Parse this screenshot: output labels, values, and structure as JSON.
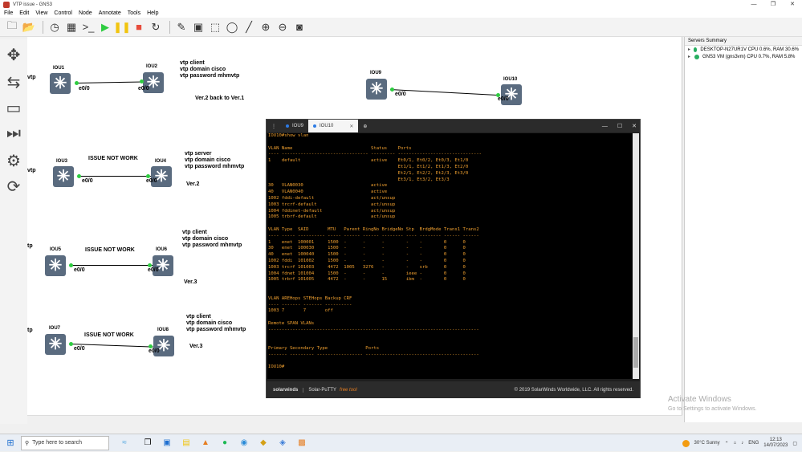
{
  "window": {
    "title": "VTP issue - GNS3",
    "controls": [
      "—",
      "❐",
      "✕"
    ]
  },
  "menu": [
    "File",
    "Edit",
    "View",
    "Control",
    "Node",
    "Annotate",
    "Tools",
    "Help"
  ],
  "toolbar_icons": [
    "folder-new-icon",
    "folder-open-icon",
    "clock-icon",
    "grid-icon",
    "terminal-icon",
    "play-icon",
    "pause-icon",
    "stop-icon",
    "reload-icon",
    "edit-icon",
    "image-icon",
    "rectangle-icon",
    "ellipse-icon",
    "line-icon",
    "zoom-in-icon",
    "zoom-out-icon",
    "screenshot-icon"
  ],
  "nodes": {
    "iou1": "IOU1",
    "iou2": "IOU2",
    "iou3": "IOU3",
    "iou4": "IOU4",
    "iou5": "IOU5",
    "iou6": "IOU6",
    "iou7": "IOU7",
    "iou8": "IOU8",
    "iou9": "IOU9",
    "iou10": "IOU10"
  },
  "interface": "e0/0",
  "notes": {
    "n1": "vtp client\nvtp domain cisco\nvtp password mhmvtp",
    "n1v": "Ver.2 back to Ver.1",
    "n2": "vtp server\nvtp domain cisco\nvtp password mhmvtp",
    "n2v": "Ver.2",
    "n3": "vtp client\nvtp domain cisco\nvtp password mhmvtp",
    "n3v": "Ver.3",
    "n4": "vtp client\nvtp domain cisco\nvtp password mhmvtp",
    "n4v": "Ver.3",
    "issue": "ISSUE NOT WORK",
    "vtp_left": "vtp",
    "tp_left": "tp"
  },
  "servers": {
    "header": "Servers Summary",
    "items": [
      "DESKTOP-N27UR1V CPU 0.6%, RAM 30.6%",
      "GNS3 VM (gns3vm) CPU 0.7%, RAM 5.8%"
    ]
  },
  "putty": {
    "tab1": "IOU9",
    "tab2": "IOU10",
    "terminal": "IOU10#show vlan\n\nVLAN Name                             Status    Ports\n---- -------------------------------- --------- -------------------------------\n1    default                          active    Et0/1, Et0/2, Et0/3, Et1/0\n                                                Et1/1, Et1/2, Et1/3, Et2/0\n                                                Et2/1, Et2/2, Et2/3, Et3/0\n                                                Et3/1, Et3/2, Et3/3\n30   VLAN0030                         active\n40   VLAN0040                         active\n1002 fddi-default                     act/unsup\n1003 trcrf-default                    act/unsup\n1004 fddinet-default                  act/unsup\n1005 trbrf-default                    act/unsup\n\nVLAN Type  SAID       MTU   Parent RingNo BridgeNo Stp  BrdgMode Trans1 Trans2\n---- ----- ---------- ----- ------ ------ -------- ---- -------- ------ ------\n1    enet  100001     1500  -      -      -        -    -        0      0\n30   enet  100030     1500  -      -      -        -    -        0      0\n40   enet  100040     1500  -      -      -        -    -        0      0\n1002 fddi  101002     1500  -      -      -        -    -        0      0\n1003 trcrf 101003     4472  1005   3276   -        -    srb      0      0\n1004 fdnet 101004     1500  -      -      -        ieee -        0      0\n1005 trbrf 101005     4472  -      -      15       ibm  -        0      0\n\n\nVLAN AREHops STEHops Backup CRF\n---- ------- ------- ----------\n1003 7       7       off\n\nRemote SPAN VLANs\n------------------------------------------------------------------------------\n\n\nPrimary Secondary Type              Ports\n------- --------- ----------------- ------------------------------------------\n\nIOU10#",
    "brand": "solarwinds",
    "product": "Solar-PuTTY",
    "free": "free tool",
    "copyright": "© 2019 SolarWinds Worldwide, LLC. All rights reserved."
  },
  "activation": {
    "title": "Activate Windows",
    "sub": "Go to Settings to activate Windows."
  },
  "taskbar": {
    "search_placeholder": "Type here to search",
    "weather": "30°C  Sunny",
    "lang": "ENG",
    "time": "12:13",
    "date": "14/07/2023"
  }
}
